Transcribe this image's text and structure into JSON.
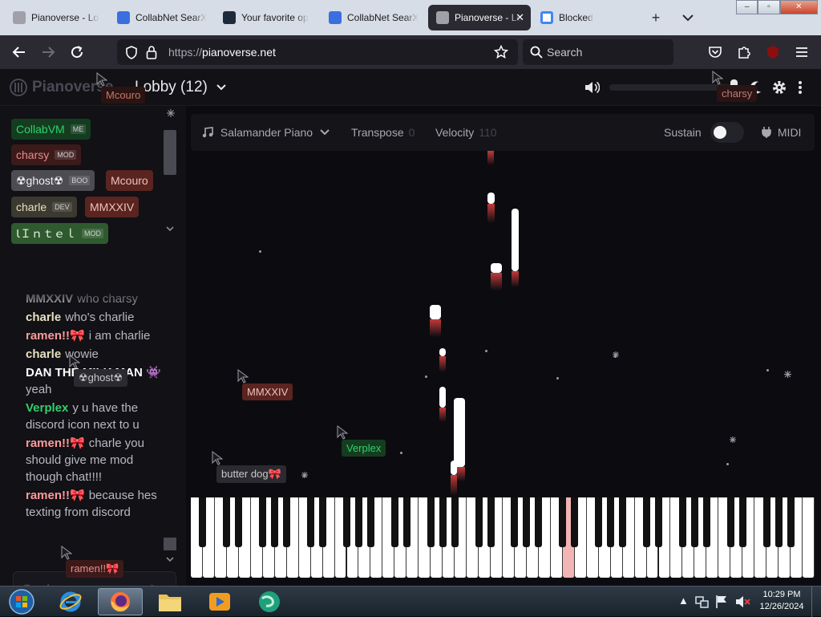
{
  "browser": {
    "tabs": [
      {
        "title": "Pianoverse - Lob",
        "favicon": "pianoverse-favicon",
        "active": false
      },
      {
        "title": "CollabNet SearX",
        "favicon": "searx-favicon",
        "active": false
      },
      {
        "title": "Your favorite op",
        "favicon": "terminal-favicon",
        "active": false
      },
      {
        "title": "CollabNet SearX",
        "favicon": "searx-favicon",
        "active": false
      },
      {
        "title": "Pianoverse - Lob",
        "favicon": "pianoverse-favicon",
        "active": true
      },
      {
        "title": "Blocked",
        "favicon": "google-favicon",
        "active": false
      }
    ],
    "new_tab": "+",
    "list_tabs": "⌄",
    "url_scheme": "https://",
    "url_host": "pianoverse.net",
    "search_placeholder": "Search"
  },
  "app": {
    "brand": "Pianoverse",
    "lobby_label": "Lobby (12)",
    "volume_level": 0.98,
    "users": [
      {
        "name": "CollabVM",
        "tag": "ME",
        "color": "#2fd06a",
        "bg": "#143d20"
      },
      {
        "name": "charsy",
        "tag": "MOD",
        "color": "#e48b8b",
        "bg": "#3d1a1a"
      },
      {
        "name": "☢ghost☢",
        "tag": "BOO",
        "color": "#f0f0f0",
        "bg": "#4c4c52"
      },
      {
        "name": "Mcouro",
        "tag": "",
        "color": "#f0c2b5",
        "bg": "#5a2420"
      },
      {
        "name": "charle",
        "tag": "DEV",
        "color": "#e8e0c0",
        "bg": "#3b3930"
      },
      {
        "name": "MMXXIV",
        "tag": "",
        "color": "#f0c2b5",
        "bg": "#5a2420"
      },
      {
        "name": "ꙆＩｎｔｅｌ",
        "tag": "MOD",
        "color": "#e0f0e0",
        "bg": "#2f5a2f"
      }
    ],
    "chat": [
      {
        "who": "MMXXIV",
        "text": "who charsy",
        "color": "#c9c9c9"
      },
      {
        "who": "charle",
        "text": "who's charlie",
        "color": "#e8e0c0"
      },
      {
        "who": "ramen!!🎀",
        "text": "i am charlie",
        "color": "#ff9a9a"
      },
      {
        "who": "charle",
        "text": "wowie",
        "color": "#e8e0c0"
      },
      {
        "who": "DAN THE MILK MAN 👾",
        "text": "yeah",
        "color": "#ffffff"
      },
      {
        "who": "Verplex",
        "text": "y u have the discord icon next to u",
        "color": "#2fd06a"
      },
      {
        "who": "ramen!!🎀",
        "text": "charle you should give me mod though chat!!!!",
        "color": "#ff9a9a"
      },
      {
        "who": "ramen!!🎀",
        "text": "because hes texting from discord",
        "color": "#ff9a9a"
      }
    ],
    "chat_placeholder": "Send a message...",
    "toolbar": {
      "instrument": "Salamander Piano",
      "transpose_label": "Transpose",
      "transpose_value": "0",
      "velocity_label": "Velocity",
      "velocity_value": "110",
      "sustain_label": "Sustain",
      "sustain_on": false,
      "midi_label": "MIDI"
    },
    "cursors": [
      {
        "name": "Mcouro",
        "color": "#c07a6a",
        "bg": "#2a1412"
      },
      {
        "name": "charsy",
        "color": "#c07a7a",
        "bg": "#2a1414"
      },
      {
        "name": "MMXXIV",
        "color": "#f0c2b5",
        "bg": "#5a2420"
      },
      {
        "name": "Verplex",
        "color": "#2fd06a",
        "bg": "#143d20"
      },
      {
        "name": "butter dog🎀",
        "color": "#c9c9c9",
        "bg": "#2a2a30"
      },
      {
        "name": "☢ghost☢",
        "color": "#c9c9c9",
        "bg": "#2a2a30"
      },
      {
        "name": "ramen!!🎀",
        "color": "#e48b8b",
        "bg": "#3d1a1a"
      }
    ]
  },
  "taskbar": {
    "time": "10:29 PM",
    "date": "12/26/2024",
    "apps": [
      "start-orb",
      "internet-explorer-icon",
      "firefox-icon",
      "file-explorer-icon",
      "media-player-icon",
      "collabvm-globe-icon"
    ]
  }
}
